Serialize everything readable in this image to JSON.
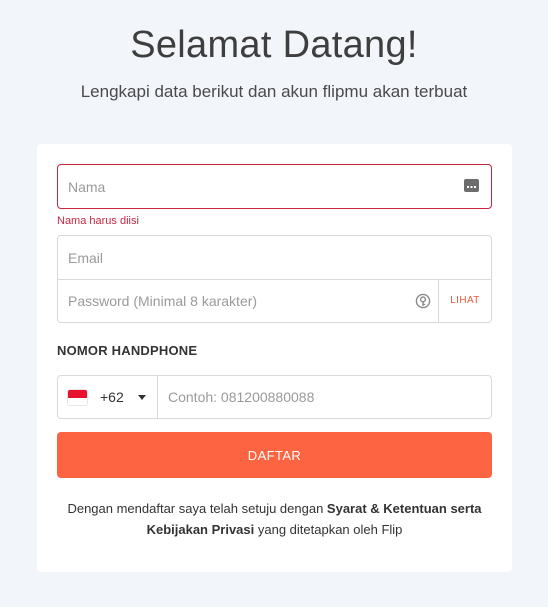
{
  "header": {
    "title": "Selamat Datang!",
    "subtitle": "Lengkapi data berikut dan akun flipmu akan terbuat"
  },
  "form": {
    "name": {
      "placeholder": "Nama",
      "value": "",
      "error": "Nama harus diisi"
    },
    "email": {
      "placeholder": "Email",
      "value": ""
    },
    "password": {
      "placeholder": "Password (Minimal 8 karakter)",
      "value": "",
      "show_label": "LIHAT"
    },
    "phone": {
      "heading": "NOMOR HANDPHONE",
      "country_code": "+62",
      "placeholder": "Contoh: 081200880088",
      "value": ""
    },
    "submit_label": "DAFTAR"
  },
  "terms": {
    "prefix": "Dengan mendaftar saya telah setuju dengan ",
    "terms_link": "Syarat & Ketentuan",
    "connector": " serta ",
    "privacy_link": "Kebijakan Privasi",
    "suffix": " yang ditetapkan oleh Flip"
  },
  "icons": {
    "name_field": "id-card-icon",
    "password_field": "key-icon",
    "country": "indonesia-flag-icon",
    "dropdown": "chevron-down-icon"
  },
  "colors": {
    "background": "#f2f5f9",
    "accent": "#fd6542",
    "error": "#c8253f",
    "link_text": "#e9593a"
  }
}
